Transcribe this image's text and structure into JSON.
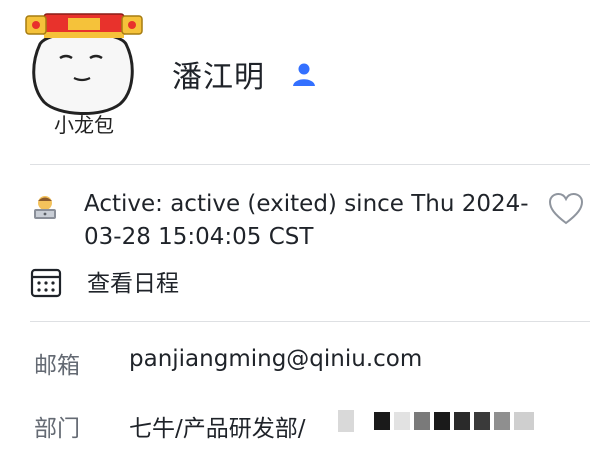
{
  "profile": {
    "avatar_caption": "小龙包",
    "name": "潘江明"
  },
  "status": {
    "emoji_icon": "technologist-emoji-icon",
    "text": "Active: active (exited) since Thu 2024-03-28 15:04:05 CST"
  },
  "schedule": {
    "label": "查看日程"
  },
  "info": {
    "email_label": "邮箱",
    "email_value": "panjiangming@qiniu.com",
    "dept_label": "部门",
    "dept_value": "七牛/产品研发部/"
  },
  "colors": {
    "icon_blue": "#3370ff",
    "label_gray": "#646a73",
    "text_dark": "#1f2329",
    "divider": "#dee0e3",
    "hat_red": "#e8322c",
    "hat_gold": "#f5c23a"
  }
}
